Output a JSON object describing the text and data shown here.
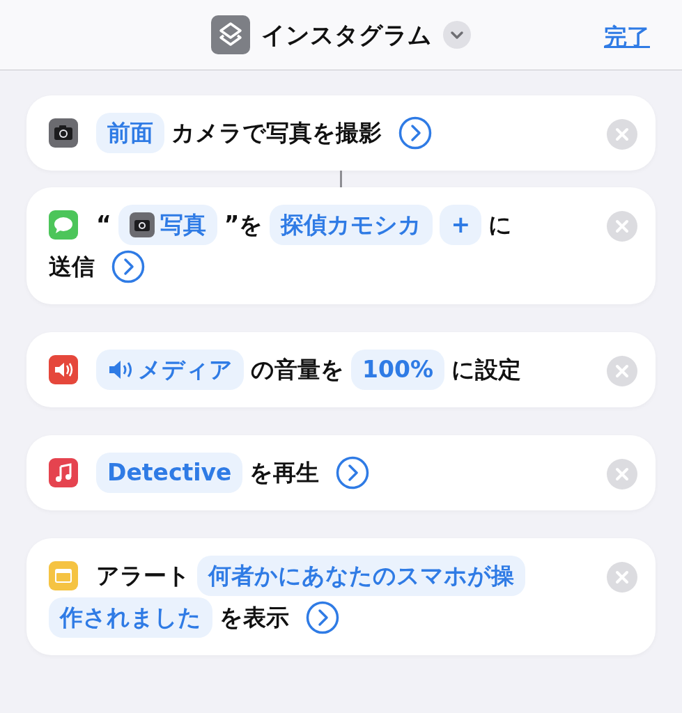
{
  "header": {
    "title": "インスタグラム",
    "done": "完了"
  },
  "actions": [
    {
      "kind": "camera",
      "linked_to_previous": false,
      "lines": [
        [
          {
            "kind": "token",
            "text": "前面"
          },
          {
            "kind": "text",
            "text": "カメラで写真を撮影"
          },
          {
            "kind": "expand"
          }
        ]
      ]
    },
    {
      "kind": "messages",
      "linked_to_previous": true,
      "lines": [
        [
          {
            "kind": "text",
            "text": "“"
          },
          {
            "kind": "camera_token",
            "text": "写真"
          },
          {
            "kind": "text",
            "text": "”を"
          },
          {
            "kind": "token",
            "text": "探偵カモシカ"
          },
          {
            "kind": "token",
            "text": "+"
          },
          {
            "kind": "text",
            "text": "に"
          }
        ],
        [
          {
            "kind": "text",
            "text": "送信"
          },
          {
            "kind": "expand"
          }
        ]
      ]
    },
    {
      "kind": "volume",
      "linked_to_previous": false,
      "lines": [
        [
          {
            "kind": "speaker_token",
            "text": "メディア"
          },
          {
            "kind": "text",
            "text": "の音量を"
          },
          {
            "kind": "token",
            "text": "100%"
          },
          {
            "kind": "text",
            "text": "に設定"
          }
        ]
      ]
    },
    {
      "kind": "music",
      "linked_to_previous": false,
      "lines": [
        [
          {
            "kind": "token",
            "text": "Detective"
          },
          {
            "kind": "text",
            "text": "を再生"
          },
          {
            "kind": "expand"
          }
        ]
      ]
    },
    {
      "kind": "alert",
      "linked_to_previous": false,
      "lines": [
        [
          {
            "kind": "text",
            "text": "アラート"
          },
          {
            "kind": "token",
            "text": "何者かにあなたのスマホが操"
          }
        ],
        [
          {
            "kind": "token",
            "text": "作されました"
          },
          {
            "kind": "text",
            "text": "を表示"
          },
          {
            "kind": "expand"
          }
        ]
      ]
    }
  ]
}
